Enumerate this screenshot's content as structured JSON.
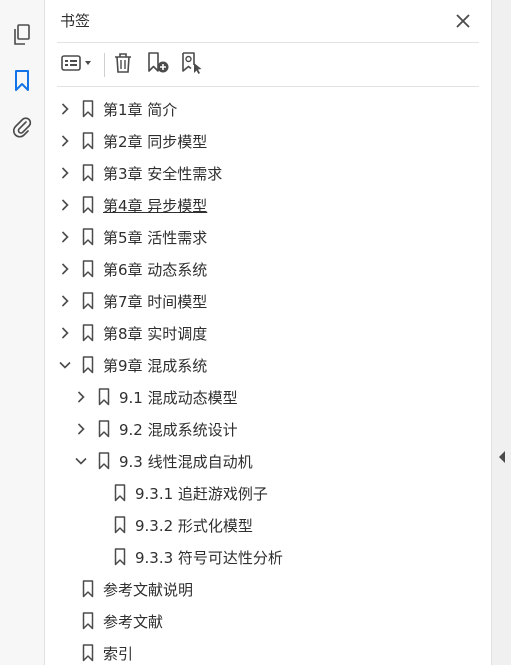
{
  "rail": {
    "icons": [
      "pages-icon",
      "bookmarks-icon",
      "attachments-icon"
    ]
  },
  "panel": {
    "title": "书签",
    "close_icon": "close-icon"
  },
  "toolbar": {
    "options_icon": "options-menu-icon",
    "delete_icon": "delete-icon",
    "new_bookmark_icon": "new-bookmark-icon",
    "new_bookmark_from_structure_icon": "bookmark-from-structure-icon"
  },
  "bookmarks": [
    {
      "label": "第1章 简介",
      "level": 0,
      "state": "collapsed"
    },
    {
      "label": "第2章 同步模型",
      "level": 0,
      "state": "collapsed"
    },
    {
      "label": "第3章 安全性需求",
      "level": 0,
      "state": "collapsed"
    },
    {
      "label": "第4章 异步模型",
      "level": 0,
      "state": "collapsed",
      "underline": true
    },
    {
      "label": "第5章 活性需求",
      "level": 0,
      "state": "collapsed"
    },
    {
      "label": "第6章 动态系统",
      "level": 0,
      "state": "collapsed"
    },
    {
      "label": "第7章 时间模型",
      "level": 0,
      "state": "collapsed"
    },
    {
      "label": "第8章 实时调度",
      "level": 0,
      "state": "collapsed"
    },
    {
      "label": "第9章 混成系统",
      "level": 0,
      "state": "expanded"
    },
    {
      "label": "9.1 混成动态模型",
      "level": 1,
      "state": "collapsed"
    },
    {
      "label": "9.2 混成系统设计",
      "level": 1,
      "state": "collapsed"
    },
    {
      "label": "9.3 线性混成自动机",
      "level": 1,
      "state": "expanded"
    },
    {
      "label": "9.3.1 追赶游戏例子",
      "level": 2,
      "state": "leaf"
    },
    {
      "label": "9.3.2 形式化模型",
      "level": 2,
      "state": "leaf"
    },
    {
      "label": "9.3.3 符号可达性分析",
      "level": 2,
      "state": "leaf"
    },
    {
      "label": "参考文献说明",
      "level": 0,
      "state": "leaf"
    },
    {
      "label": "参考文献",
      "level": 0,
      "state": "leaf"
    },
    {
      "label": "索引",
      "level": 0,
      "state": "leaf"
    }
  ],
  "colors": {
    "accent": "#1473e6",
    "icon": "#4b4b4b"
  }
}
